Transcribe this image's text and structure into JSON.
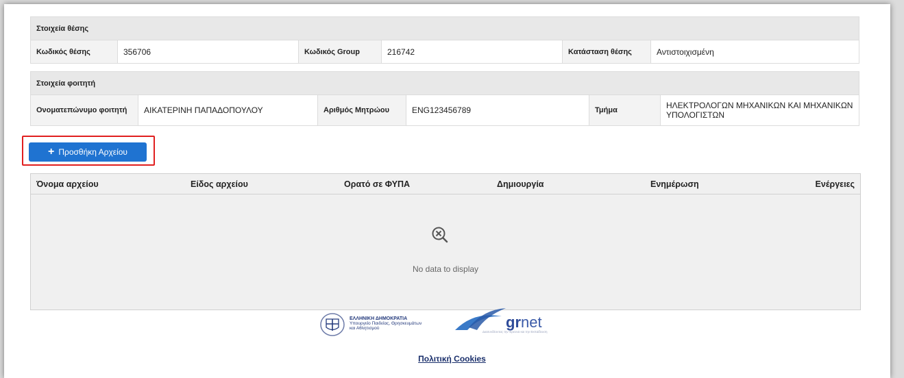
{
  "position_section": {
    "title": "Στοιχεία θέσης",
    "fields": [
      {
        "label": "Κωδικός θέσης",
        "value": "356706"
      },
      {
        "label": "Κωδικός Group",
        "value": "216742"
      },
      {
        "label": "Κατάσταση θέσης",
        "value": "Αντιστοιχισμένη"
      }
    ]
  },
  "student_section": {
    "title": "Στοιχεία φοιτητή",
    "fields": [
      {
        "label": "Ονοματεπώνυμο φοιτητή",
        "value": "ΑΙΚΑΤΕΡΙΝΗ ΠΑΠΑΔΟΠΟΥΛΟΥ"
      },
      {
        "label": "Αριθμός Μητρώου",
        "value": "ENG123456789"
      },
      {
        "label": "Τμήμα",
        "value": "ΗΛΕΚΤΡΟΛΟΓΩΝ ΜΗΧΑΝΙΚΩΝ ΚΑΙ ΜΗΧΑΝΙΚΩΝ ΥΠΟΛΟΓΙΣΤΩΝ"
      }
    ]
  },
  "add_file_button": {
    "label": "Προσθήκη Αρχείου",
    "icon": "plus-icon"
  },
  "files_grid": {
    "columns": [
      "Όνομα αρχείου",
      "Είδος αρχείου",
      "Ορατό σε ΦΥΠΑ",
      "Δημιουργία",
      "Ενημέρωση",
      "Ενέργειες"
    ],
    "empty_message": "No data to display",
    "empty_icon": "no-data-icon"
  },
  "footer": {
    "ministry_title": "ΕΛΛΗΝΙΚΗ ΔΗΜΟΚΡΑΤΙΑ",
    "ministry_line1": "Υπουργείο Παιδείας, Θρησκευμάτων",
    "ministry_line2": "και Αθλητισμού",
    "grnet_logo_text_a": "gr",
    "grnet_logo_text_b": "net",
    "grnet_tagline": "Διασυνδέοντας την Έρευνα και την Εκπαίδευση",
    "cookies_link": "Πολιτική Cookies"
  },
  "colors": {
    "button_bg": "#1f73d1",
    "highlight_border": "#e01e1e",
    "header_bg": "#e8e8e8",
    "link": "#1a2f6b"
  }
}
